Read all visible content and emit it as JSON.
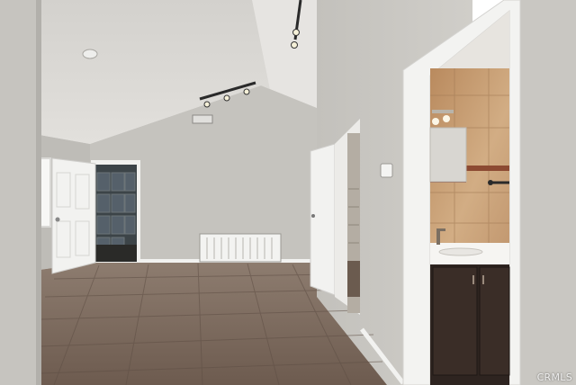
{
  "photo": {
    "watermark": "CRMLS"
  },
  "palette": {
    "wall": "#c9c7c2",
    "wall_shadow": "#b3b1ac",
    "ceiling": "#dcdad6",
    "floor": "#7f6d60",
    "trim": "#efefed",
    "cabinet": "#2e2420",
    "tile": "#c8a27a"
  }
}
